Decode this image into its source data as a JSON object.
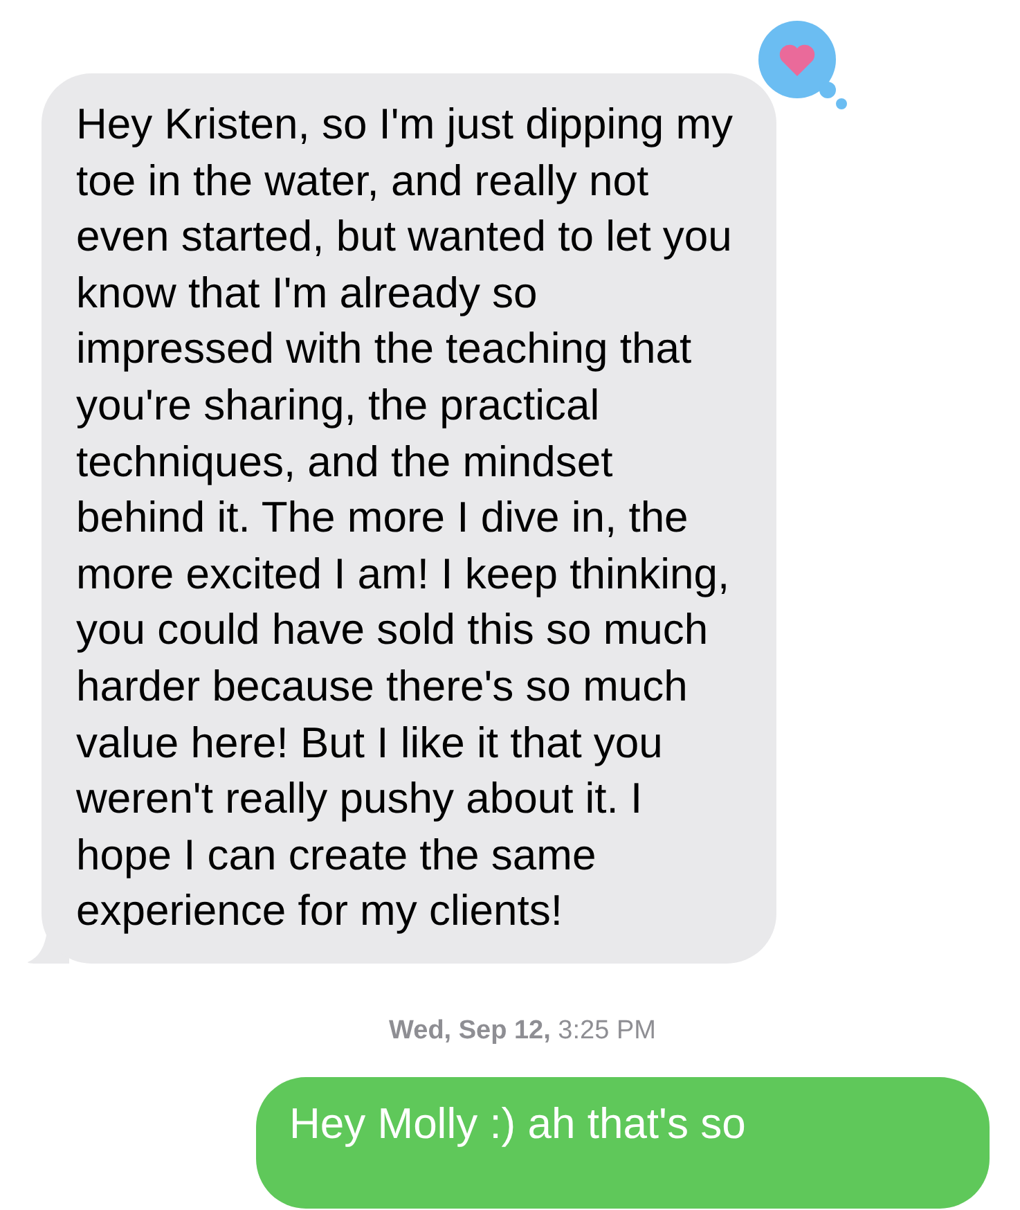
{
  "thread": [
    {
      "kind": "incoming",
      "text": "Hey Kristen, so I'm just dipping my toe in the water, and really not even started, but wanted to let you know that I'm already so impressed with the teaching that you're sharing, the practical techniques, and the mindset behind it. The more I dive in, the more excited I am! I keep thinking, you could have sold this so much harder because there's so much value here! But I like it that you weren't really pushy about it. I hope I can create the same experience for my clients!",
      "heart_reaction": true
    },
    {
      "kind": "timestamp",
      "text": "**Wed, Sep 12,** 3:25 PM"
    },
    {
      "kind": "outgoing",
      "text": "Hey Molly :) ah that's so"
    }
  ]
}
